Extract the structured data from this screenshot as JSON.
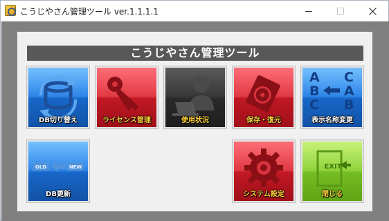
{
  "window": {
    "title": "こうじやさん管理ツール   ver.1.1.1.1"
  },
  "header": {
    "title": "こうじやさん管理ツール"
  },
  "tiles": {
    "db_switch": {
      "label": "DB切り替え"
    },
    "license": {
      "label": "ライセンス管理"
    },
    "usage": {
      "label": "使用状況"
    },
    "backup": {
      "label": "保存・復元"
    },
    "display_name": {
      "label": "表示名称変更",
      "art_letters": [
        "A",
        "C",
        "B",
        "A",
        "C",
        "B"
      ]
    },
    "db_update": {
      "label": "DB更新",
      "art_old": "OLD",
      "art_new": "NEW"
    },
    "system_settings": {
      "label": "システム設定"
    },
    "close": {
      "label": "閉じる",
      "art_exit": "EXIT"
    }
  },
  "colors": {
    "blue_tile": "#2f86e8",
    "red_tile": "#c01823",
    "dark_tile": "#383838",
    "green_tile": "#92d43c",
    "label_yellow": "#ffd23a"
  }
}
